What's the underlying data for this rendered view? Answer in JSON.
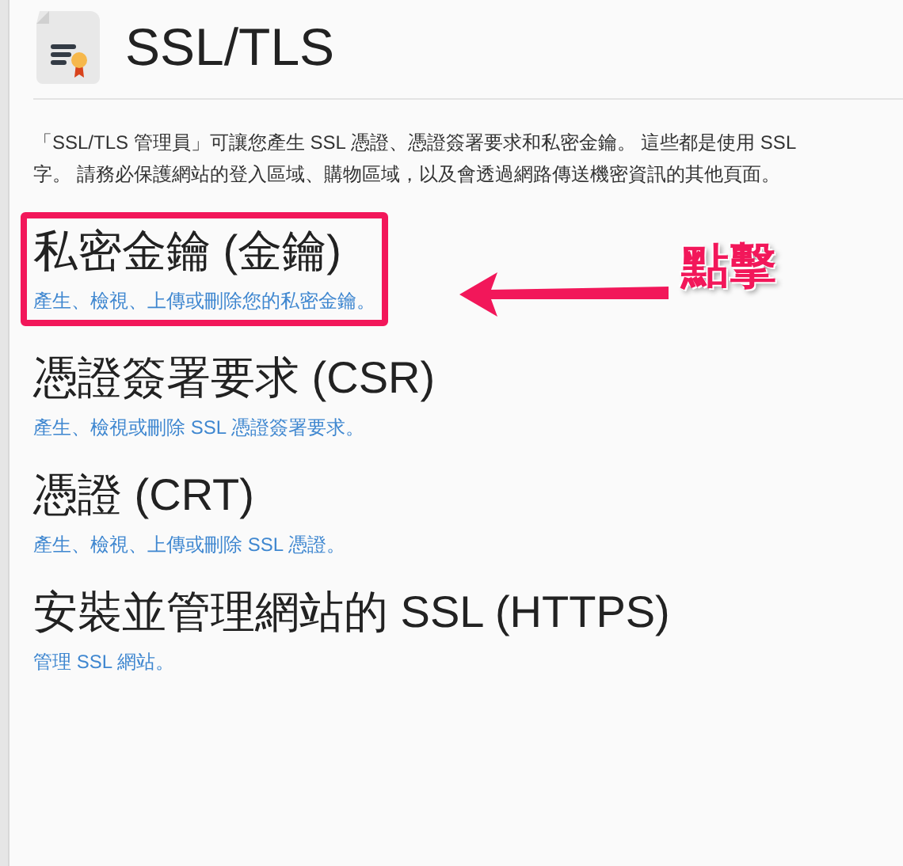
{
  "page": {
    "title": "SSL/TLS"
  },
  "intro_lines": [
    "「SSL/TLS 管理員」可讓您產生 SSL 憑證、憑證簽署要求和私密金鑰。 這些都是使用 SSL",
    "字。 請務必保護網站的登入區域、購物區域，以及會透過網路傳送機密資訊的其他頁面。"
  ],
  "sections": [
    {
      "title": "私密金鑰 (金鑰)",
      "description": "產生、檢視、上傳或刪除您的私密金鑰。",
      "highlighted": true
    },
    {
      "title": "憑證簽署要求 (CSR)",
      "description": "產生、檢視或刪除 SSL 憑證簽署要求。",
      "highlighted": false
    },
    {
      "title": "憑證 (CRT)",
      "description": "產生、檢視、上傳或刪除 SSL 憑證。",
      "highlighted": false
    },
    {
      "title": "安裝並管理網站的 SSL (HTTPS)",
      "description": "管理 SSL 網站。",
      "highlighted": false
    }
  ],
  "annotation": {
    "label": "點擊"
  }
}
